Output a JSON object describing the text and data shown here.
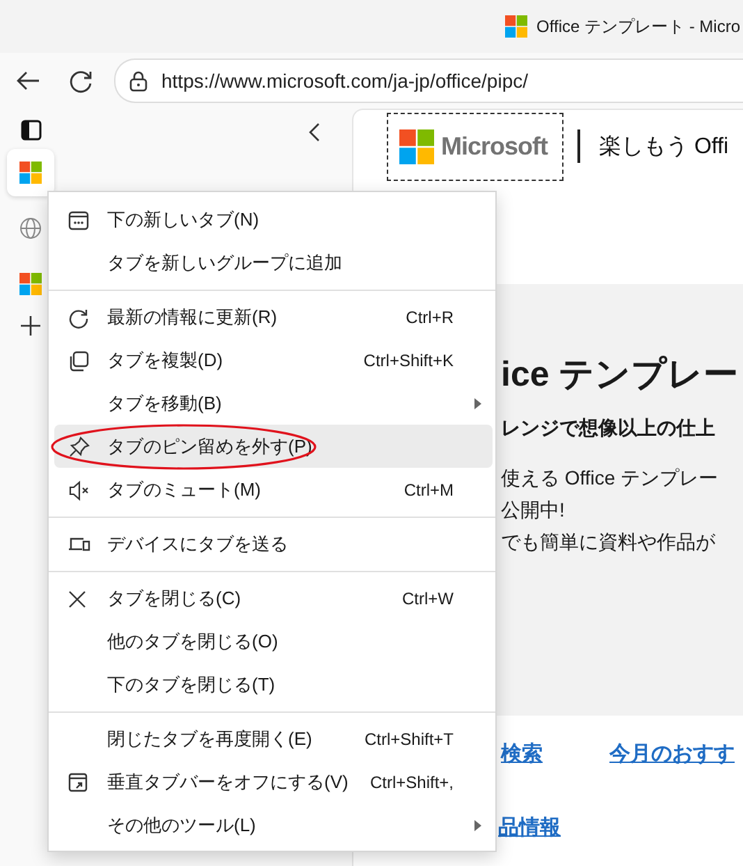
{
  "window": {
    "tab_title": "Office テンプレート - Micro"
  },
  "toolbar": {
    "url": "https://www.microsoft.com/ja-jp/office/pipc/"
  },
  "sidebar": {
    "tabs": [
      {
        "selected": true
      },
      {
        "selected": false
      },
      {
        "selected": false
      }
    ]
  },
  "page": {
    "logo_text": "Microsoft",
    "header_title": "楽しもう Offi",
    "hero_title": "ice テンプレー",
    "hero_subtitle": "レンジで想像以上の仕上",
    "hero_lines": [
      "使える Office テンプレー",
      "公開中!",
      "でも簡単に資料や作品が"
    ],
    "links": [
      "検索",
      "今月のおすす"
    ],
    "bottom_link": "品情報"
  },
  "context_menu": {
    "groups": [
      [
        {
          "label": "下の新しいタブ(N)",
          "selected": false,
          "circled": false
        },
        {
          "label": "タブを新しいグループに追加",
          "selected": false,
          "circled": false
        }
      ],
      [
        {
          "label": "最新の情報に更新(R)",
          "shortcut": "Ctrl+R",
          "selected": false,
          "circled": false
        },
        {
          "label": "タブを複製(D)",
          "shortcut": "Ctrl+Shift+K",
          "selected": false,
          "circled": false
        },
        {
          "label": "タブを移動(B)",
          "submenu": true,
          "selected": false,
          "circled": false
        },
        {
          "label": "タブのピン留めを外す(P)",
          "selected": true,
          "circled": true
        },
        {
          "label": "タブのミュート(M)",
          "shortcut": "Ctrl+M",
          "selected": false,
          "circled": false
        }
      ],
      [
        {
          "label": "デバイスにタブを送る",
          "selected": false,
          "circled": false
        }
      ],
      [
        {
          "label": "タブを閉じる(C)",
          "shortcut": "Ctrl+W",
          "selected": false,
          "circled": false
        },
        {
          "label": "他のタブを閉じる(O)",
          "selected": false,
          "circled": false
        },
        {
          "label": "下のタブを閉じる(T)",
          "selected": false,
          "circled": false
        }
      ],
      [
        {
          "label": "閉じたタブを再度開く(E)",
          "shortcut": "Ctrl+Shift+T",
          "selected": false,
          "circled": false
        },
        {
          "label": "垂直タブバーをオフにする(V)",
          "shortcut": "Ctrl+Shift+,",
          "selected": false,
          "circled": false
        },
        {
          "label": "その他のツール(L)",
          "submenu": true,
          "selected": false,
          "circled": false
        }
      ]
    ]
  }
}
